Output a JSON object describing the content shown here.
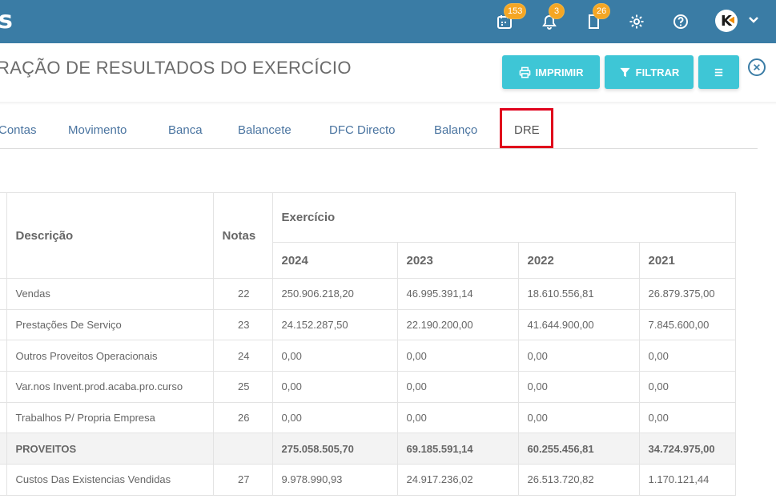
{
  "app": {
    "brand_fragment": "s"
  },
  "topbar": {
    "calendar_badge": "153",
    "bell_badge": "3",
    "doc_badge": "26",
    "colors": {
      "bar": "#3a7ca5",
      "badge": "#f5a623"
    }
  },
  "header": {
    "title": "RAÇÃO DE RESULTADOS DO EXERCÍCIO",
    "print_label": "IMPRIMIR",
    "filter_label": "FILTRAR",
    "accent": "#3ec6d6"
  },
  "tabs": [
    {
      "label": "Contas"
    },
    {
      "label": "Movimento"
    },
    {
      "label": "Banca"
    },
    {
      "label": "Balancete"
    },
    {
      "label": "DFC Directo"
    },
    {
      "label": "Balanço"
    },
    {
      "label": "DRE",
      "active": true
    }
  ],
  "table": {
    "col_descricao": "Descrição",
    "col_notas": "Notas",
    "group_exercicio": "Exercício",
    "years": [
      "2024",
      "2023",
      "2022",
      "2021"
    ],
    "rows": [
      {
        "descricao": "Vendas",
        "nota": "22",
        "values": [
          "250.906.218,20",
          "46.995.391,14",
          "18.610.556,81",
          "26.879.375,00"
        ]
      },
      {
        "descricao": "Prestações De Serviço",
        "nota": "23",
        "values": [
          "24.152.287,50",
          "22.190.200,00",
          "41.644.900,00",
          "7.845.600,00"
        ]
      },
      {
        "descricao": "Outros Proveitos Operacionais",
        "nota": "24",
        "values": [
          "0,00",
          "0,00",
          "0,00",
          "0,00"
        ]
      },
      {
        "descricao": "Var.nos Invent.prod.acaba.pro.curso",
        "nota": "25",
        "values": [
          "0,00",
          "0,00",
          "0,00",
          "0,00"
        ]
      },
      {
        "descricao": "Trabalhos P/ Propria Empresa",
        "nota": "26",
        "values": [
          "0,00",
          "0,00",
          "0,00",
          "0,00"
        ]
      },
      {
        "descricao": "PROVEITOS",
        "nota": "",
        "total": true,
        "values": [
          "275.058.505,70",
          "69.185.591,14",
          "60.255.456,81",
          "34.724.975,00"
        ]
      },
      {
        "descricao": "Custos Das Existencias Vendidas",
        "nota": "27",
        "values": [
          "9.978.990,93",
          "24.917.236,02",
          "26.513.720,82",
          "1.170.121,44"
        ]
      }
    ]
  }
}
